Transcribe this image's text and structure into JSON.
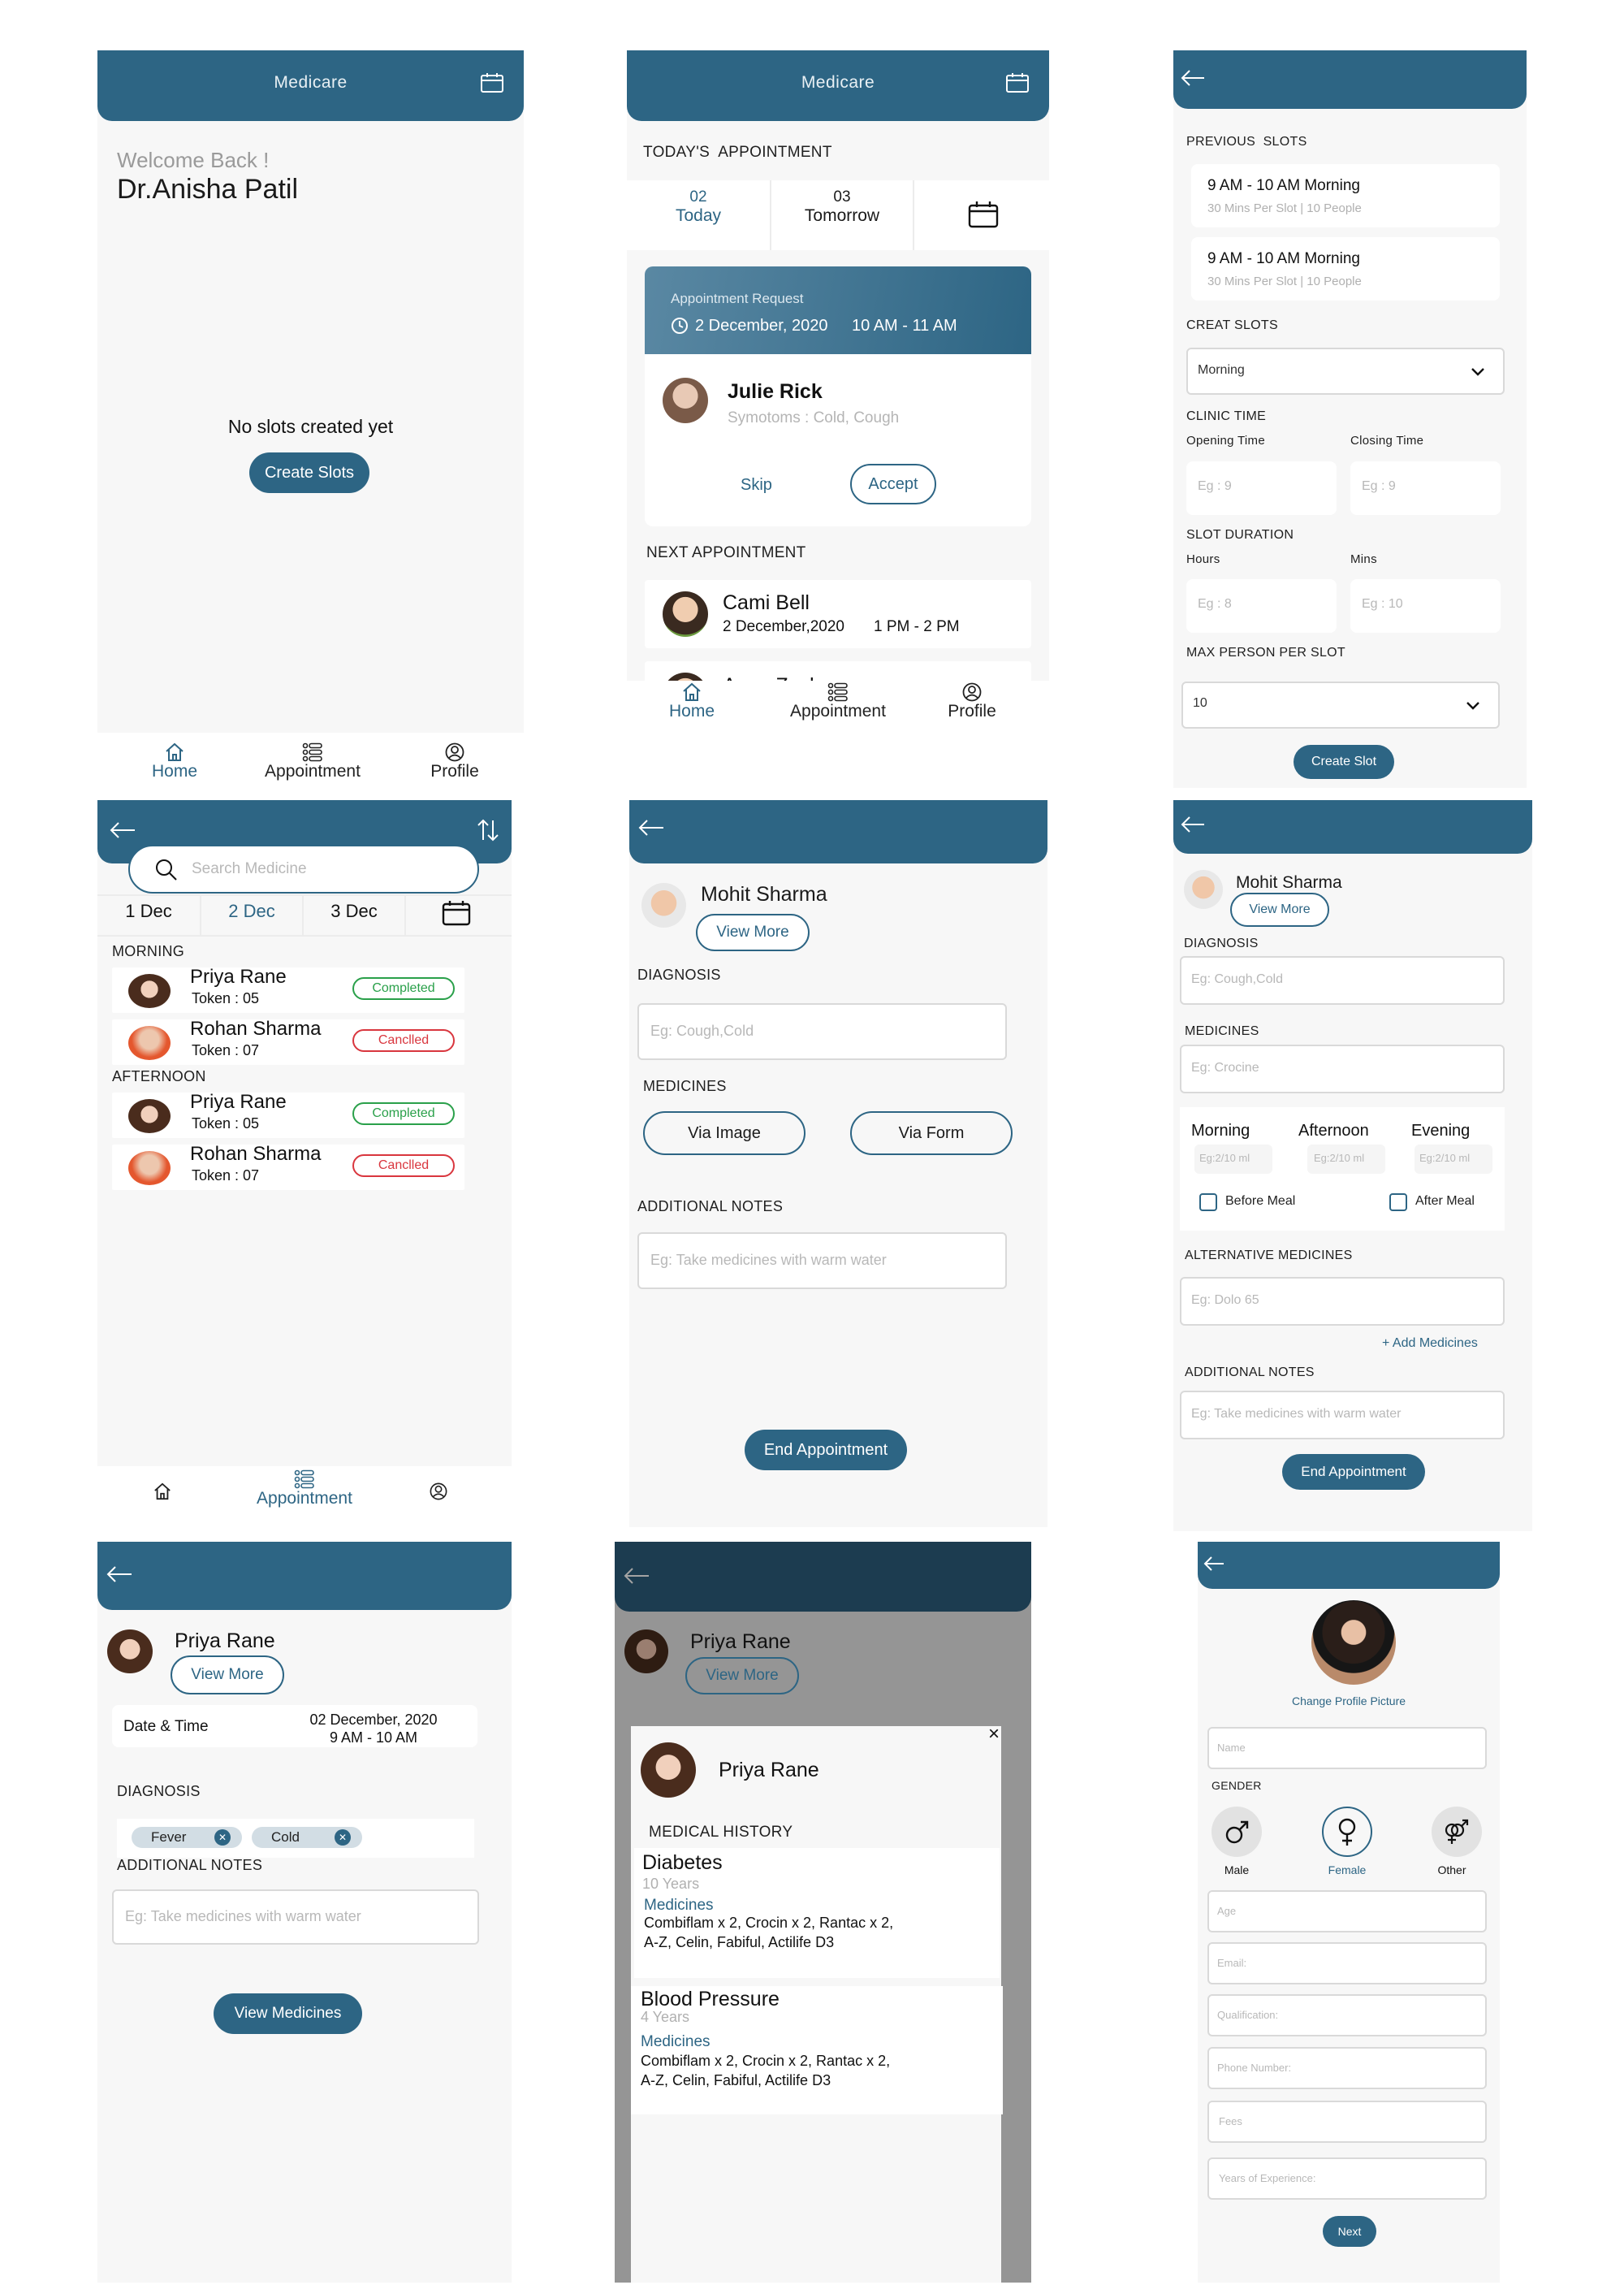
{
  "app": {
    "name": "Medicare",
    "accent": "#2d6584",
    "completed_color": "#2aa04a",
    "cancelled_color": "#d9363e"
  },
  "nav": {
    "home": "Home",
    "appointment": "Appointment",
    "profile": "Profile"
  },
  "home_empty": {
    "welcome": "Welcome Back !",
    "doctor_name": "Dr.Anisha Patil",
    "empty_message": "No slots created yet",
    "create_button": "Create Slots"
  },
  "home_today": {
    "section_title": "TODAY'S  APPOINTMENT",
    "date_tabs": [
      {
        "day": "02",
        "label": "Today",
        "active": true
      },
      {
        "day": "03",
        "label": "Tomorrow",
        "active": false
      }
    ],
    "request": {
      "title": "Appointment Request",
      "date": "2 December, 2020",
      "time": "10 AM - 11 AM",
      "patient_name": "Julie Rick",
      "symptoms": "Symotoms : Cold, Cough",
      "skip_label": "Skip",
      "accept_label": "Accept"
    },
    "next_title": "NEXT APPOINTMENT",
    "next": [
      {
        "name": "Cami Bell",
        "date": "2 December,2020",
        "time": "1 PM - 2 PM"
      },
      {
        "name": "Anna Zach"
      }
    ]
  },
  "slots": {
    "previous_title": "PREVIOUS  SLOTS",
    "previous": [
      {
        "title": "9 AM - 10 AM Morning",
        "sub": "30 Mins Per Slot | 10 People"
      },
      {
        "title": "9 AM - 10 AM Morning",
        "sub": "30 Mins Per Slot | 10 People"
      }
    ],
    "create_title": "CREAT SLOTS",
    "period_value": "Morning",
    "clinic_time_title": "CLINIC TIME",
    "opening_label": "Opening Time",
    "closing_label": "Closing Time",
    "opening_ph": "Eg : 9",
    "closing_ph": "Eg : 9",
    "duration_title": "SLOT DURATION",
    "hours_label": "Hours",
    "mins_label": "Mins",
    "hours_ph": "Eg : 8",
    "mins_ph": "Eg : 10",
    "max_title": "MAX PERSON PER SLOT",
    "max_value": "10",
    "create_button": "Create Slot"
  },
  "appointments_list": {
    "search_placeholder": "Search Medicine",
    "dates": [
      {
        "label": "1 Dec",
        "active": false
      },
      {
        "label": "2 Dec",
        "active": true
      },
      {
        "label": "3 Dec",
        "active": false
      }
    ],
    "morning_title": "MORNING",
    "afternoon_title": "AFTERNOON",
    "morning": [
      {
        "name": "Priya Rane",
        "token": "Token : 05",
        "status": "Completed"
      },
      {
        "name": "Rohan Sharma",
        "token": "Token : 07",
        "status": "Canclled"
      }
    ],
    "afternoon": [
      {
        "name": "Priya Rane",
        "token": "Token : 05",
        "status": "Completed"
      },
      {
        "name": "Rohan Sharma",
        "token": "Token : 07",
        "status": "Canclled"
      }
    ]
  },
  "consult_simple": {
    "patient": "Mohit Sharma",
    "view_more": "View More",
    "diagnosis_title": "DIAGNOSIS",
    "diagnosis_ph": "Eg: Cough,Cold",
    "medicines_title": "MEDICINES",
    "via_image": "Via Image",
    "via_form": "Via Form",
    "notes_title": "ADDITIONAL NOTES",
    "notes_ph": "Eg: Take medicines with warm water",
    "end_button": "End Appointment"
  },
  "consult_form": {
    "patient": "Mohit Sharma",
    "view_more": "View More",
    "diagnosis_title": "DIAGNOSIS",
    "diagnosis_ph": "Eg: Cough,Cold",
    "medicines_title": "MEDICINES",
    "medicines_ph": "Eg: Crocine",
    "morning": "Morning",
    "afternoon": "Afternoon",
    "evening": "Evening",
    "dose_ph": "Eg:2/10 ml",
    "before_meal": "Before Meal",
    "after_meal": "After Meal",
    "alt_title": "ALTERNATIVE MEDICINES",
    "alt_ph": "Eg: Dolo 65",
    "add_medicines": "+ Add Medicines",
    "notes_title": "ADDITIONAL NOTES",
    "notes_ph": "Eg: Take medicines with warm water",
    "end_button": "End Appointment"
  },
  "appointment_detail": {
    "patient": "Priya Rane",
    "view_more": "View More",
    "datetime_label": "Date & Time",
    "date": "02 December, 2020",
    "time": "9 AM - 10 AM",
    "diagnosis_title": "DIAGNOSIS",
    "chips": [
      "Fever",
      "Cold"
    ],
    "notes_title": "ADDITIONAL NOTES",
    "notes_ph": "Eg: Take medicines with warm water",
    "view_medicines": "View Medicines"
  },
  "history_modal": {
    "patient": "Priya Rane",
    "view_more": "View More",
    "close": "×",
    "title": "MEDICAL HISTORY",
    "items": [
      {
        "condition": "Diabetes",
        "duration": "10 Years",
        "med_label": "Medicines",
        "meds_line1": "Combiflam x 2, Crocin x 2, Rantac x 2,",
        "meds_line2": "A-Z, Celin, Fabiful, Actilife D3"
      },
      {
        "condition": "Blood Pressure",
        "duration": "4 Years",
        "med_label": "Medicines",
        "meds_line1": "Combiflam x 2, Crocin x 2, Rantac x 2,",
        "meds_line2": "A-Z, Celin, Fabiful, Actilife D3"
      }
    ]
  },
  "profile_edit": {
    "change_picture": "Change Profile Picture",
    "name_ph": "Name",
    "gender_title": "GENDER",
    "genders": [
      {
        "label": "Male",
        "selected": false
      },
      {
        "label": "Female",
        "selected": true
      },
      {
        "label": "Other",
        "selected": false
      }
    ],
    "age_ph": "Age",
    "email_ph": "Email:",
    "qualification_ph": "Qualification:",
    "phone_ph": "Phone Number:",
    "fees_ph": "Fees",
    "experience_ph": "Years of Experience:",
    "next_button": "Next"
  }
}
